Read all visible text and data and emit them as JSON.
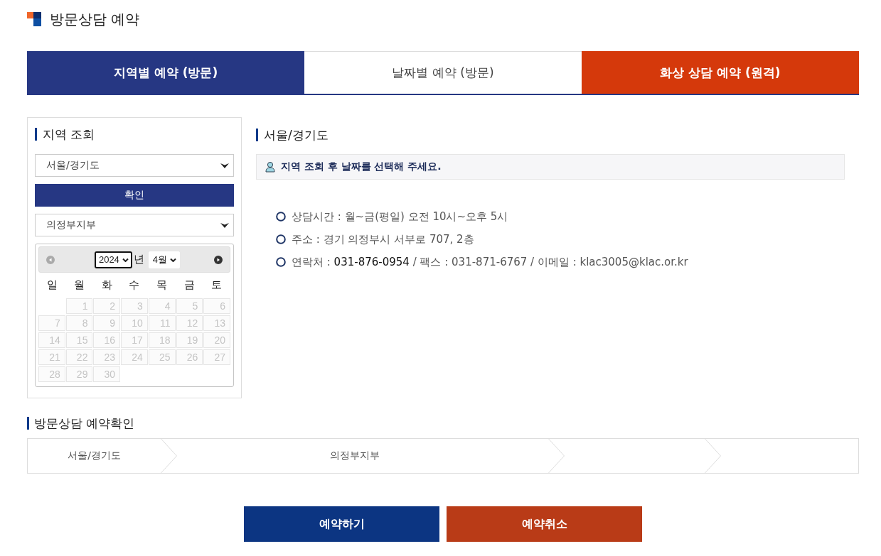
{
  "page_title": "방문상담 예약",
  "tabs": [
    {
      "label": "지역별 예약 (방문)",
      "selected": true,
      "kind": "plain"
    },
    {
      "label": "날짜별 예약 (방문)",
      "selected": false,
      "kind": "plain"
    },
    {
      "label": "화상 상담 예약 (원격)",
      "selected": false,
      "kind": "accent"
    }
  ],
  "region_search": {
    "heading": "지역 조회",
    "region_select": "서울/경기도",
    "confirm_button": "확인",
    "branch_select": "의정부지부",
    "calendar": {
      "prev": {
        "disabled": true
      },
      "next": {
        "disabled": false
      },
      "year": {
        "value": "2024",
        "focused": true
      },
      "year_suffix": "년",
      "month": {
        "value": "4월",
        "focused": false
      },
      "weekdays": [
        "일",
        "월",
        "화",
        "수",
        "목",
        "금",
        "토"
      ],
      "weeks": [
        [
          {
            "day": "1",
            "disabled": true
          },
          {
            "day": "2",
            "disabled": true
          },
          {
            "day": "3",
            "disabled": true
          },
          {
            "day": "4",
            "disabled": true
          },
          {
            "day": "5",
            "disabled": true
          },
          {
            "day": "6",
            "disabled": true
          }
        ],
        [
          {
            "day": "7",
            "disabled": true
          },
          {
            "day": "8",
            "disabled": true
          },
          {
            "day": "9",
            "disabled": true
          },
          {
            "day": "10",
            "disabled": true
          },
          {
            "day": "11",
            "disabled": true
          },
          {
            "day": "12",
            "disabled": true
          },
          {
            "day": "13",
            "disabled": true
          }
        ],
        [
          {
            "day": "14",
            "disabled": true
          },
          {
            "day": "15",
            "disabled": true
          },
          {
            "day": "16",
            "disabled": true
          },
          {
            "day": "17",
            "disabled": true
          },
          {
            "day": "18",
            "disabled": true
          },
          {
            "day": "19",
            "disabled": true
          },
          {
            "day": "20",
            "disabled": true
          }
        ],
        [
          {
            "day": "21",
            "disabled": true
          },
          {
            "day": "22",
            "disabled": true
          },
          {
            "day": "23",
            "disabled": true
          },
          {
            "day": "24",
            "disabled": true
          },
          {
            "day": "25",
            "disabled": true
          },
          {
            "day": "26",
            "disabled": true
          },
          {
            "day": "27",
            "disabled": true
          }
        ],
        [
          {
            "day": "28",
            "disabled": true
          },
          {
            "day": "29",
            "disabled": true
          },
          {
            "day": "30",
            "disabled": true
          }
        ]
      ]
    }
  },
  "detail": {
    "heading": "서울/경기도",
    "notice": "지역 조회 후 날짜를 선택해 주세요.",
    "info": [
      {
        "parts": [
          {
            "text": "상담시간 : 월~금(평일) 오전 10시~오후 5시",
            "highlight": false
          }
        ]
      },
      {
        "parts": [
          {
            "text": "주소 : 경기 의정부시 서부로 707, 2층",
            "highlight": false
          }
        ]
      },
      {
        "parts": [
          {
            "text": "연락처 : ",
            "highlight": false
          },
          {
            "text": "031-876-0954",
            "highlight": true
          },
          {
            "text": " / 팩스 : 031-871-6767 / 이메일 : klac3005@klac.or.kr",
            "highlight": false
          }
        ]
      }
    ]
  },
  "confirmation": {
    "heading": "방문상담 예약확인",
    "steps": [
      {
        "label": "서울/경기도"
      },
      {
        "label": "의정부지부"
      }
    ]
  },
  "buttons": [
    {
      "label": "예약하기",
      "kind": "primary"
    },
    {
      "label": "예약취소",
      "kind": "danger"
    }
  ]
}
